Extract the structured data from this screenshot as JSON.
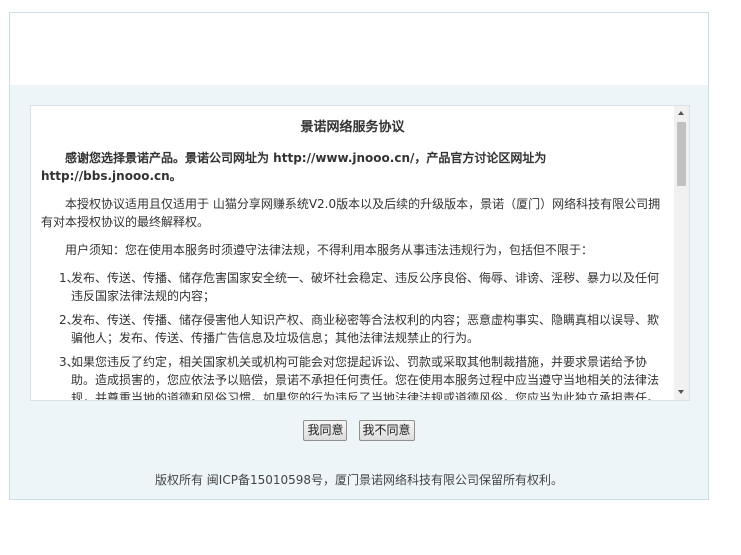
{
  "license": {
    "title": "景诺网络服务协议",
    "intro": "感谢您选择景诺产品。景诺公司网址为 http://www.jnooo.cn/，产品官方讨论区网址为 http://bbs.jnooo.cn。",
    "scope": "本授权协议适用且仅适用于 山猫分享网赚系统V2.0版本以及后续的升级版本，景诺（厦门）网络科技有限公司拥有对本授权协议的最终解释权。",
    "notice": "用户须知：您在使用本服务时须遵守法律法规，不得利用本服务从事违法违规行为，包括但不限于：",
    "items": [
      {
        "num": "1、",
        "text": "发布、传送、传播、储存危害国家安全统一、破坏社会稳定、违反公序良俗、侮辱、诽谤、淫秽、暴力以及任何违反国家法律法规的内容；"
      },
      {
        "num": "2、",
        "text": "发布、传送、传播、储存侵害他人知识产权、商业秘密等合法权利的内容；恶意虚构事实、隐瞒真相以误导、欺骗他人；发布、传送、传播广告信息及垃圾信息；其他法律法规禁止的行为。"
      },
      {
        "num": "3、",
        "text": "如果您违反了约定，相关国家机关或机构可能会对您提起诉讼、罚款或采取其他制裁措施，并要求景诺给予协助。造成损害的，您应依法予以赔偿，景诺不承担任何责任。您在使用本服务过程中应当遵守当地相关的法律法规，并尊重当地的道德和风俗习惯。如果您的行为违反了当地法律法规或道德风俗，您应当为此独立承担责任。"
      }
    ]
  },
  "buttons": {
    "agree": "我同意",
    "disagree": "我不同意"
  },
  "footer": {
    "copyright": "版权所有 闽ICP备15010598号，厦门景诺网络科技有限公司保留所有权利。"
  }
}
